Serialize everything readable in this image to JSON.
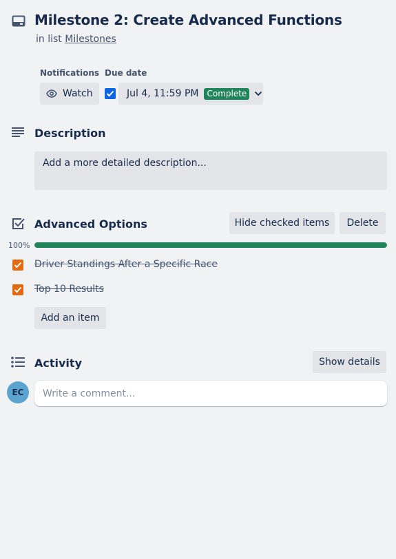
{
  "card": {
    "title": "Milestone 2: Create Advanced Functions",
    "in_list_prefix": "in list",
    "list_name": "Milestones"
  },
  "notifications": {
    "label": "Notifications",
    "watch_label": "Watch"
  },
  "due_date": {
    "label": "Due date",
    "checked": true,
    "value": "Jul 4, 11:59 PM",
    "status_badge": "Complete",
    "badge_color": "#1f845a"
  },
  "description": {
    "heading": "Description",
    "placeholder_text": "Add a more detailed description..."
  },
  "checklist": {
    "heading": "Advanced Options",
    "hide_checked_label": "Hide checked items",
    "delete_label": "Delete",
    "progress_percent_label": "100%",
    "progress_fraction": 1.0,
    "progress_color": "#1f845a",
    "items": [
      {
        "label": "Driver Standings After a Specific Race",
        "checked": true
      },
      {
        "label": "Top 10 Results",
        "checked": true
      }
    ],
    "checkbox_color": "#e56910",
    "add_item_label": "Add an item"
  },
  "activity": {
    "heading": "Activity",
    "show_details_label": "Show details",
    "avatar_initials": "EC",
    "comment_placeholder": "Write a comment..."
  },
  "icons": {
    "card": "card-icon",
    "watch": "eye-icon",
    "due_checkbox": "checkbox-checked-icon",
    "chevron": "chevron-down-icon",
    "description": "description-lines-icon",
    "checklist": "checklist-icon",
    "activity": "activity-list-icon"
  }
}
